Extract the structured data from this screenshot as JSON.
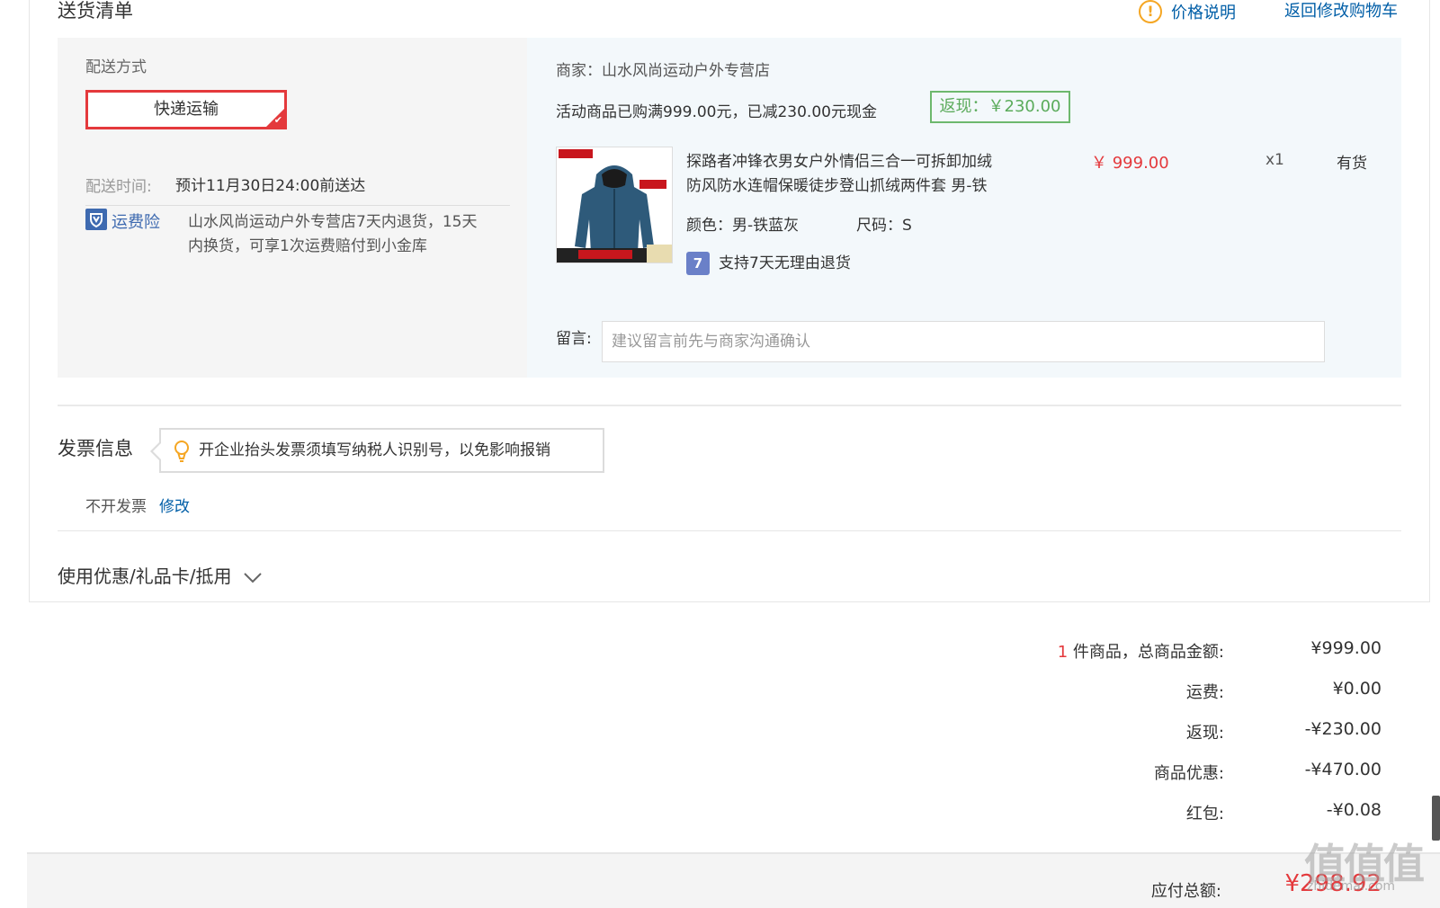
{
  "header": {
    "title": "送货清单",
    "price_note": "价格说明",
    "back_to_cart": "返回修改购物车"
  },
  "delivery": {
    "method_label": "配送方式",
    "method_value": "快递运输",
    "time_label": "配送时间:",
    "time_value": "预计11月30日24:00前送达",
    "insurance_label": "运费险",
    "insurance_text_line1": "山水风尚运动户外专营店7天内退货，15天",
    "insurance_text_line2": "内换货，可享1次运费赔付到小金库"
  },
  "merchant": {
    "name_line": "商家：山水风尚运动户外专营店",
    "promo_line": "活动商品已购满999.00元，已减230.00元现金",
    "rebate_badge": "返现：￥230.00"
  },
  "product": {
    "title_line1": "探路者冲锋衣男女户外情侣三合一可拆卸加绒",
    "title_line2": "防风防水连帽保暖徒步登山抓绒两件套 男-铁",
    "price": "￥ 999.00",
    "quantity": "x1",
    "stock": "有货",
    "color": "颜色：男-铁蓝灰",
    "size": "尺码：S",
    "return_policy": "支持7天无理由退货",
    "return_icon_text": "7"
  },
  "note": {
    "label": "留言:",
    "placeholder": "建议留言前先与商家沟通确认"
  },
  "invoice": {
    "title": "发票信息",
    "tip": "开企业抬头发票须填写纳税人识别号，以免影响报销",
    "status": "不开发票",
    "edit": "修改"
  },
  "discounts": {
    "title": "使用优惠/礼品卡/抵用"
  },
  "summary": {
    "count": "1",
    "count_label": "件商品，总商品金额:",
    "total_value": "¥999.00",
    "shipping_label": "运费:",
    "shipping_value": "¥0.00",
    "rebate_label": "返现:",
    "rebate_value": "-¥230.00",
    "discount_label": "商品优惠:",
    "discount_value": "-¥470.00",
    "redpacket_label": "红包:",
    "redpacket_value": "-¥0.08",
    "payable_label": "应付总额:",
    "payable_value": "¥298.92"
  },
  "watermark": {
    "big": "值值值",
    "small": "zhidemai.com"
  },
  "colors": {
    "accent_red": "#e4393c",
    "link_blue": "#005ea7",
    "rebate_green": "#5bab5b"
  }
}
